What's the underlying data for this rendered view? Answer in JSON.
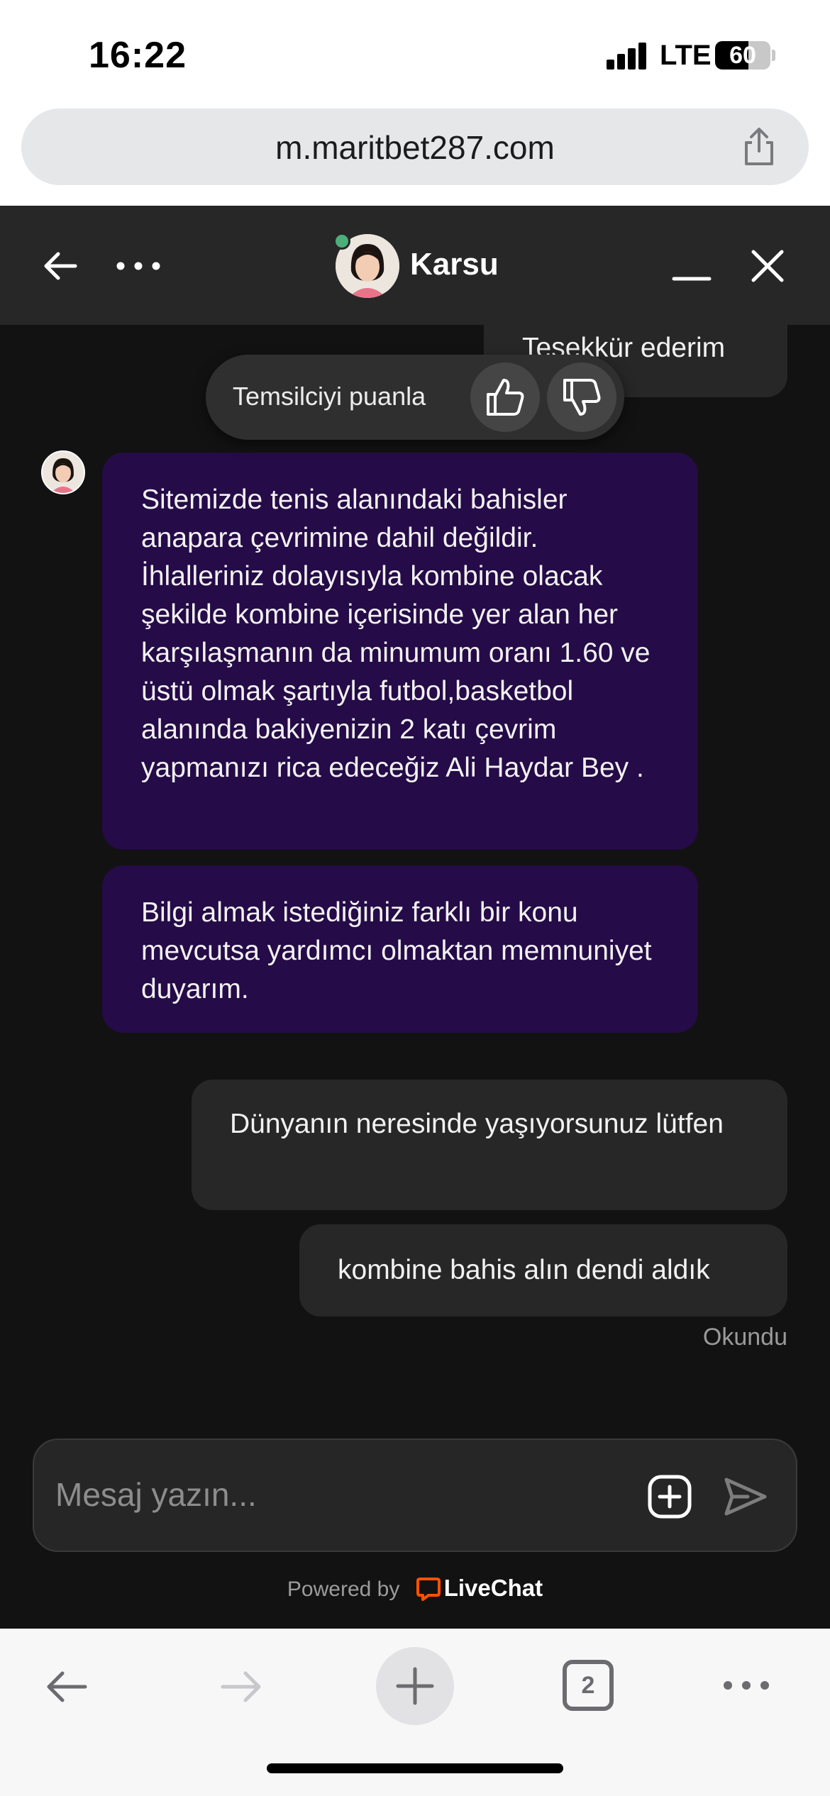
{
  "status_bar": {
    "time": "16:22",
    "network": "LTE",
    "battery": "60",
    "battery_level": 0.6
  },
  "browser": {
    "url": "m.maritbet287.com"
  },
  "chat": {
    "agent_name": "Karsu",
    "previous_message": "Teşekkür ederim",
    "rating": {
      "label": "Temsilciyi puanla"
    },
    "messages": [
      {
        "from": "agent",
        "text": "Sitemizde tenis alanındaki bahisler anapara çevrimine dahil değildir. İhlalleriniz dolayısıyla kombine olacak şekilde kombine içerisinde yer alan her karşılaşmanın da minumum oranı 1.60 ve üstü olmak şartıyla futbol,basketbol alanında bakiyenizin 2 katı çevrim yapmanızı rica edeceğiz Ali Haydar Bey ."
      },
      {
        "from": "agent",
        "text": "Bilgi almak istediğiniz farklı bir konu mevcutsa yardımcı olmaktan memnuniyet duyarım."
      },
      {
        "from": "user",
        "text": "Dünyanın neresinde yaşıyorsunuz lütfen"
      },
      {
        "from": "user",
        "text": "kombine bahis alın dendi aldık"
      }
    ],
    "read_status": "Okundu",
    "input": {
      "placeholder": "Mesaj yazın..."
    },
    "powered_by": {
      "prefix": "Powered by",
      "brand": "LiveChat"
    }
  },
  "toolbar": {
    "tab_count": "2"
  },
  "colors": {
    "header_bg": "#272727",
    "chat_bg": "#121212",
    "agent_bubble": "#250b47",
    "user_bubble": "#272727",
    "online": "#4caf7a",
    "livechat_brand": "#ff5100"
  },
  "icons": [
    "back-arrow-icon",
    "more-dots-icon",
    "minimize-icon",
    "close-icon",
    "thumbs-up-icon",
    "thumbs-down-icon",
    "attach-icon",
    "send-icon",
    "share-icon",
    "plus-icon",
    "livechat-logo-icon"
  ]
}
